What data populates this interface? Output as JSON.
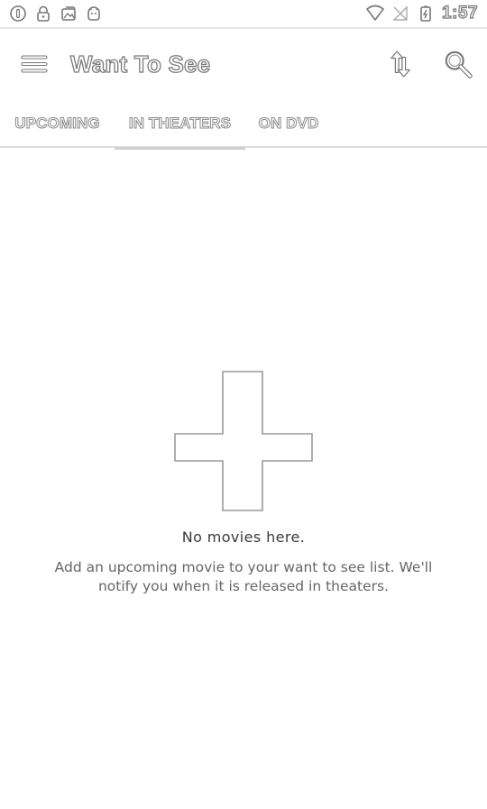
{
  "status_bar": {
    "time": "1:57",
    "icons": [
      "circle-info-icon",
      "lock-icon",
      "image-icon",
      "android-icon",
      "wifi-icon",
      "no-signal-icon",
      "battery-icon"
    ]
  },
  "app_bar": {
    "title": "Want To See",
    "icons": [
      "menu-icon",
      "sort-icon",
      "search-icon"
    ]
  },
  "tabs": [
    {
      "label": "UPCOMING",
      "active": false
    },
    {
      "label": "IN THEATERS",
      "active": true
    },
    {
      "label": "ON DVD",
      "active": false
    }
  ],
  "empty_state": {
    "icon": "plus-icon",
    "title": "No movies here.",
    "description": "Add an upcoming movie to your want to see list. We'll notify you when it is released in theaters."
  }
}
